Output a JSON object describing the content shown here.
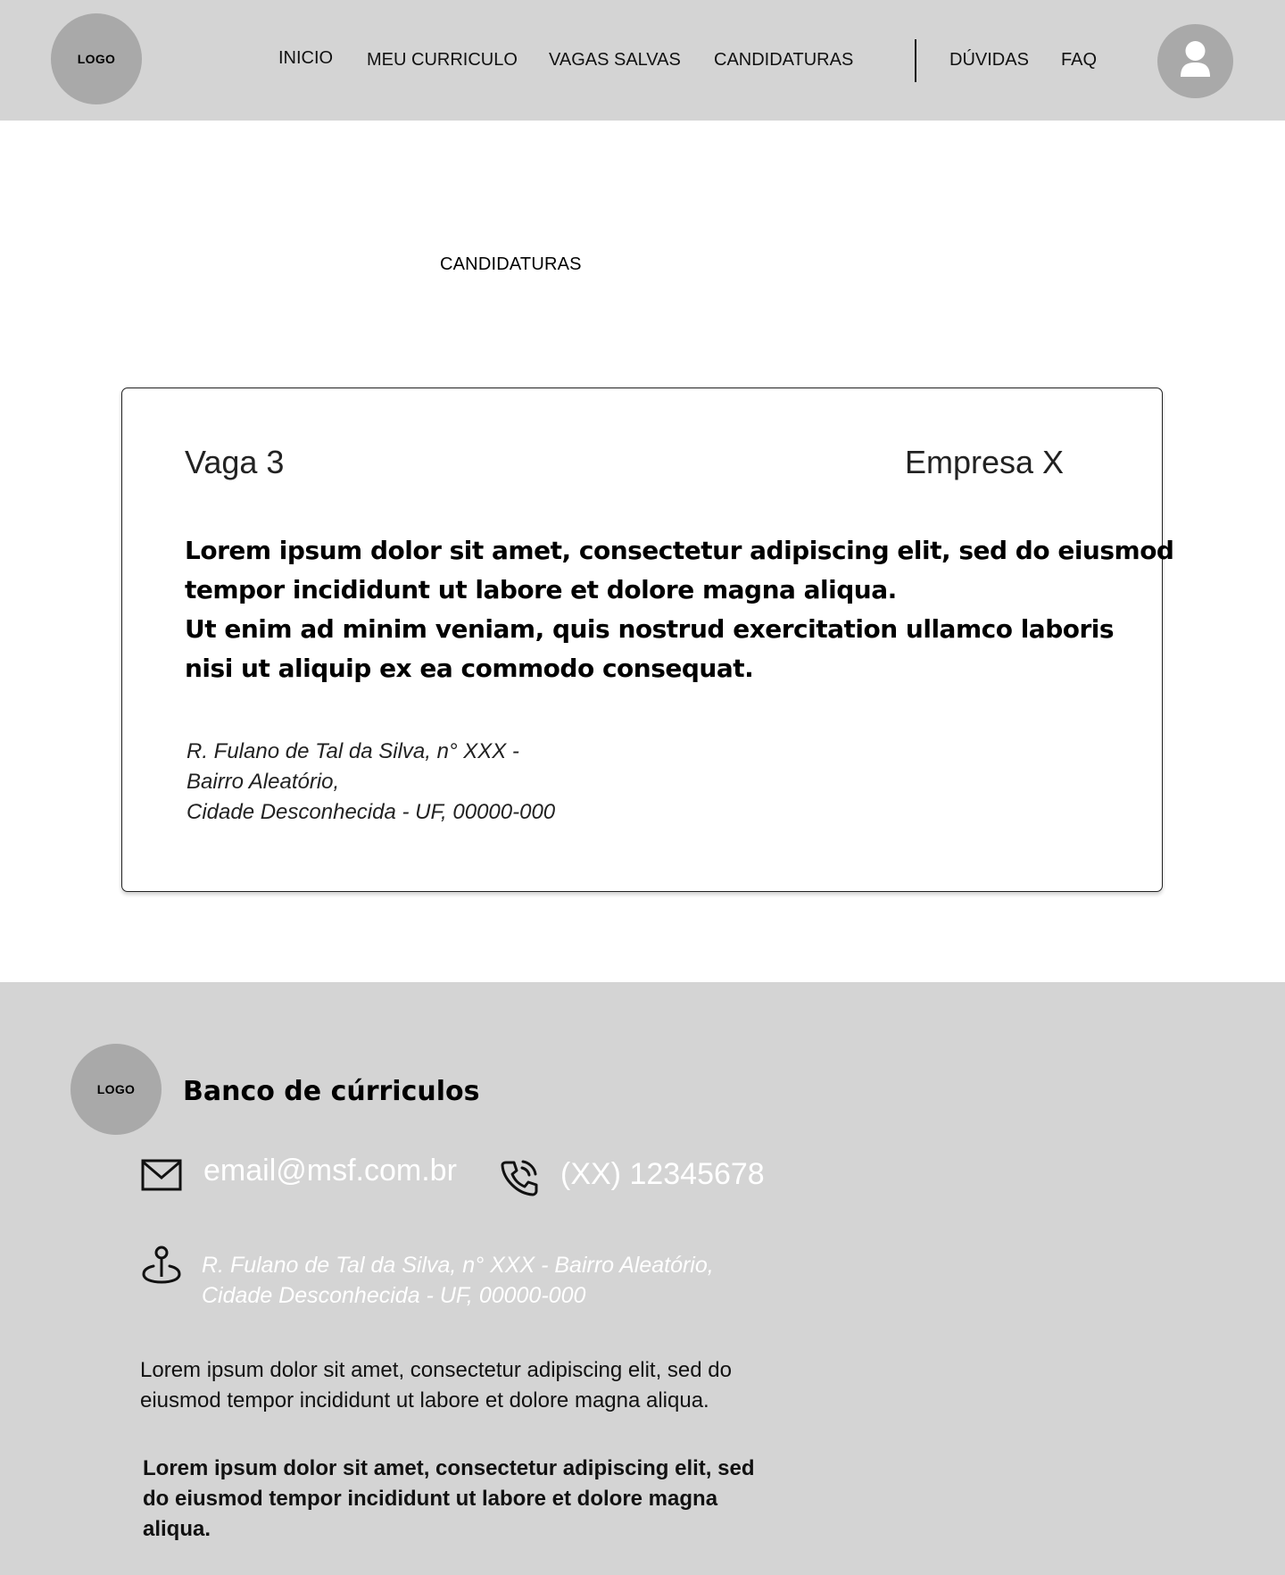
{
  "header": {
    "logo": "LOGO",
    "nav": [
      "INICIO",
      "MEU CURRICULO",
      "VAGAS SALVAS",
      "CANDIDATURAS"
    ],
    "help_links": [
      "DÚVIDAS",
      "FAQ"
    ],
    "avatar_icon": "user-icon"
  },
  "page": {
    "title": "CANDIDATURAS"
  },
  "card": {
    "job_title": "Vaga 3",
    "company": "Empresa X",
    "description_lines": [
      "Lorem ipsum dolor sit amet, consectetur adipiscing elit, sed do eiusmod",
      "tempor incididunt ut labore et dolore magna aliqua.",
      "Ut enim ad minim veniam, quis nostrud exercitation ullamco laboris",
      "nisi ut aliquip ex ea commodo consequat."
    ],
    "address_lines": [
      "R. Fulano de Tal da Silva, n° XXX -",
      "Bairro Aleatório,",
      "Cidade Desconhecida - UF, 00000-000"
    ]
  },
  "footer": {
    "logo": "LOGO",
    "brand": "Banco de cúrriculos",
    "email": "email@msf.com.br",
    "email_icon": "mail-icon",
    "phone": "(XX) 12345678",
    "phone_icon": "phone-icon",
    "location_icon": "location-pin-icon",
    "address_lines": [
      "R. Fulano de Tal da Silva, n° XXX - Bairro Aleatório,",
      "Cidade Desconhecida - UF, 00000-000"
    ],
    "paragraph": "Lorem ipsum dolor sit amet, consectetur adipiscing elit, sed do eiusmod tempor incididunt ut labore et dolore magna aliqua.",
    "paragraph_bold": "Lorem ipsum dolor sit amet, consectetur adipiscing elit, sed do eiusmod tempor incididunt ut labore et dolore magna aliqua."
  }
}
